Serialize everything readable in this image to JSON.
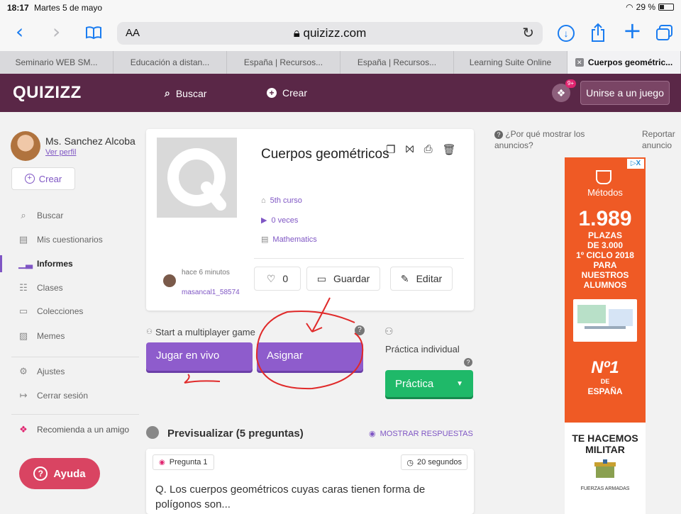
{
  "status_bar": {
    "time": "18:17",
    "date": "Martes 5 de mayo",
    "battery": "29 %"
  },
  "safari": {
    "text_size": "AA",
    "url": "quizizz.com"
  },
  "tabs": [
    {
      "label": "Seminario WEB SM..."
    },
    {
      "label": "Educación a distan..."
    },
    {
      "label": "España | Recursos..."
    },
    {
      "label": "España | Recursos..."
    },
    {
      "label": "Learning Suite Online"
    },
    {
      "label": "Cuerpos geométric..."
    }
  ],
  "nav": {
    "logo": "QUIZIZZ",
    "search_label": "Buscar",
    "create_label": "Crear",
    "notifications_badge": "9+",
    "join_label": "Unirse a un juego"
  },
  "sidebar": {
    "user_name": "Ms. Sanchez Alcoba",
    "view_profile": "Ver perfil",
    "create_label": "Crear",
    "items": [
      {
        "label": "Buscar",
        "icon": "search-icon"
      },
      {
        "label": "Mis cuestionarios",
        "icon": "document-icon"
      },
      {
        "label": "Informes",
        "icon": "chart-icon"
      },
      {
        "label": "Clases",
        "icon": "classes-icon"
      },
      {
        "label": "Colecciones",
        "icon": "folder-icon"
      },
      {
        "label": "Memes",
        "icon": "image-icon"
      }
    ],
    "settings_label": "Ajustes",
    "logout_label": "Cerrar sesión",
    "recommend_label": "Recomienda a un amigo",
    "help_label": "Ayuda"
  },
  "quiz": {
    "title": "Cuerpos geométricos",
    "grade": "5th curso",
    "plays": "0 veces",
    "subject": "Mathematics",
    "author_time": "hace 6 minutos",
    "author_name": "masancal1_58574",
    "likes": "0",
    "save_label": "Guardar",
    "edit_label": "Editar"
  },
  "multiplayer": {
    "label": "Start a multiplayer game",
    "live_label": "Jugar en vivo",
    "assign_label": "Asignar",
    "solo_label": "Práctica individual",
    "practice_label": "Práctica"
  },
  "preview": {
    "title": "Previsualizar (5 preguntas)",
    "show_answers": "MOSTRAR RESPUESTAS",
    "question_label": "Pregunta 1",
    "question_time": "20 segundos",
    "question_text": "Q. Los cuerpos geométricos cuyas caras tienen forma de polígonos son..."
  },
  "ads": {
    "why_label": "¿Por qué mostrar los anuncios?",
    "report_label": "Reportar anuncio",
    "brand": "Métodos",
    "big_number": "1.989",
    "plazas": "PLAZAS",
    "line2": "DE 3.000",
    "line3": "1º CICLO 2018",
    "line4": "PARA",
    "line5": "NUESTROS",
    "line6": "ALUMNOS",
    "badge_n": "Nº1",
    "badge_de": "DE",
    "badge_country": "ESPAÑA",
    "bottom_title": "TE HACEMOS MILITAR",
    "bottom_caption": "FUERZAS ARMADAS",
    "colors": {
      "ad_orange": "#ef5a25",
      "purple": "#8e5ccc",
      "green": "#1fb969",
      "nav": "#5a2747"
    }
  }
}
